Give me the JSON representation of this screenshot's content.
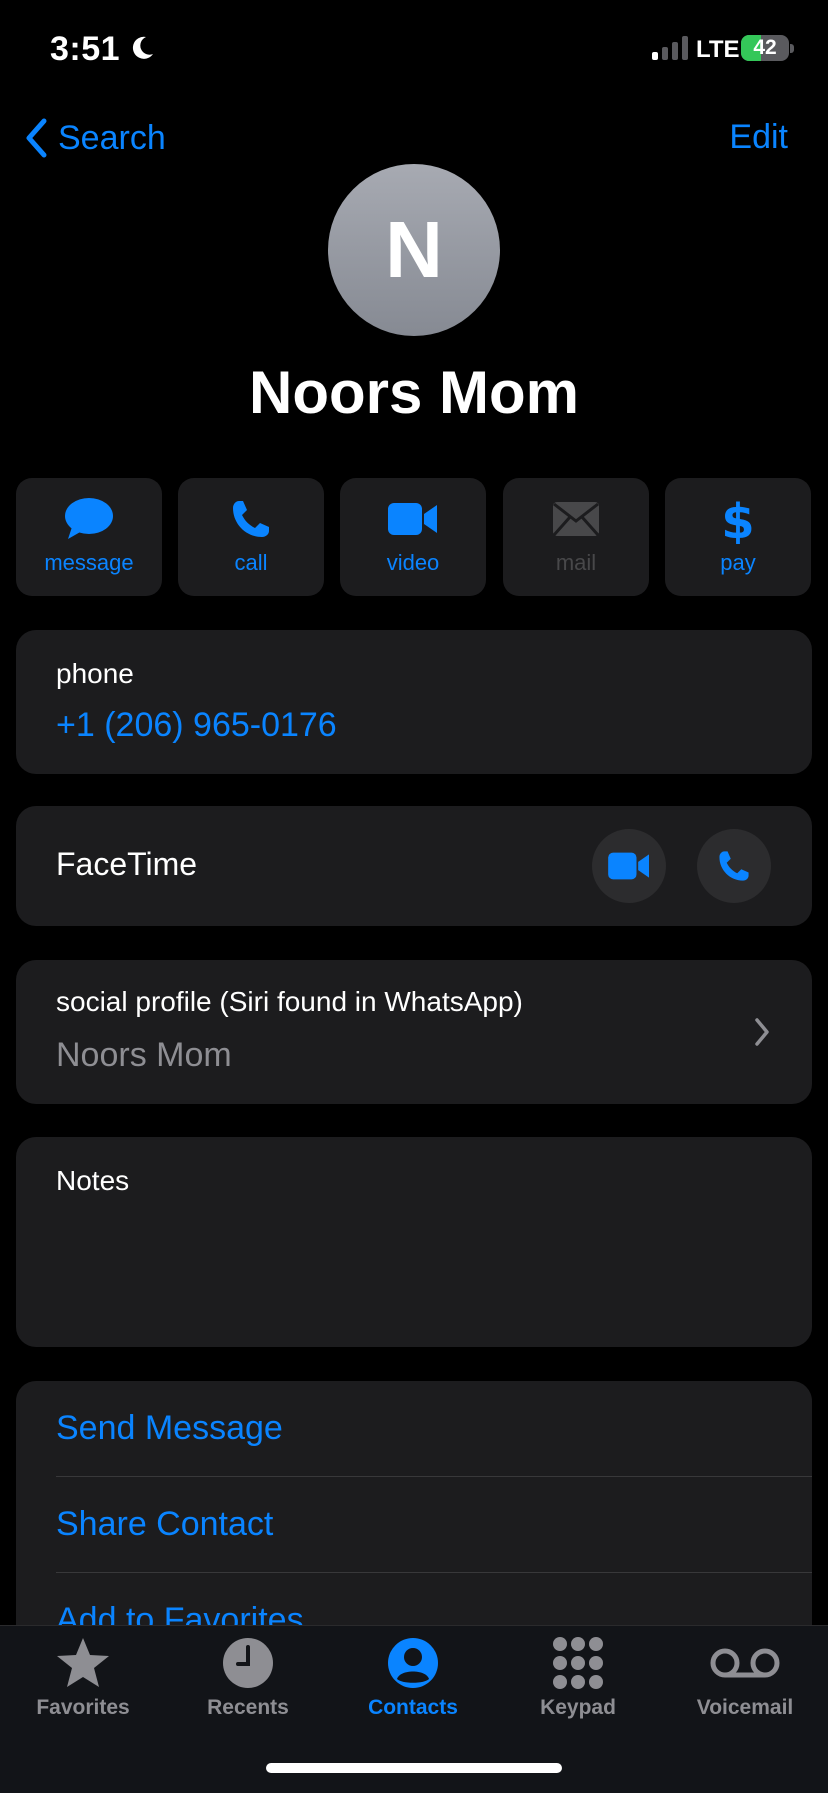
{
  "status_bar": {
    "time": "3:51",
    "network": "LTE",
    "battery_percent": 42,
    "battery_label": "42",
    "signal_bars_active": 1
  },
  "nav": {
    "back_label": "Search",
    "edit_label": "Edit"
  },
  "contact": {
    "initial": "N",
    "name": "Noors Mom"
  },
  "actions": [
    {
      "label": "message",
      "icon": "message-bubble-icon",
      "enabled": true
    },
    {
      "label": "call",
      "icon": "phone-icon",
      "enabled": true
    },
    {
      "label": "video",
      "icon": "video-camera-icon",
      "enabled": true
    },
    {
      "label": "mail",
      "icon": "envelope-icon",
      "enabled": false
    },
    {
      "label": "pay",
      "icon": "dollar-icon",
      "enabled": true
    }
  ],
  "phone_section": {
    "label": "phone",
    "number": "+1 (206) 965-0176"
  },
  "facetime_section": {
    "label": "FaceTime"
  },
  "social_section": {
    "label": "social profile (Siri found in WhatsApp)",
    "value": "Noors Mom"
  },
  "notes_section": {
    "label": "Notes"
  },
  "links": {
    "send_message": "Send Message",
    "share_contact": "Share Contact",
    "add_to_favorites": "Add to Favorites"
  },
  "tabs": [
    {
      "label": "Favorites",
      "icon": "star-icon",
      "active": false
    },
    {
      "label": "Recents",
      "icon": "clock-icon",
      "active": false
    },
    {
      "label": "Contacts",
      "icon": "person-circle-icon",
      "active": true
    },
    {
      "label": "Keypad",
      "icon": "keypad-icon",
      "active": false
    },
    {
      "label": "Voicemail",
      "icon": "voicemail-icon",
      "active": false
    }
  ],
  "colors": {
    "accent": "#0a84ff",
    "background": "#000000",
    "card": "#1c1c1e",
    "battery": "#34c759"
  }
}
